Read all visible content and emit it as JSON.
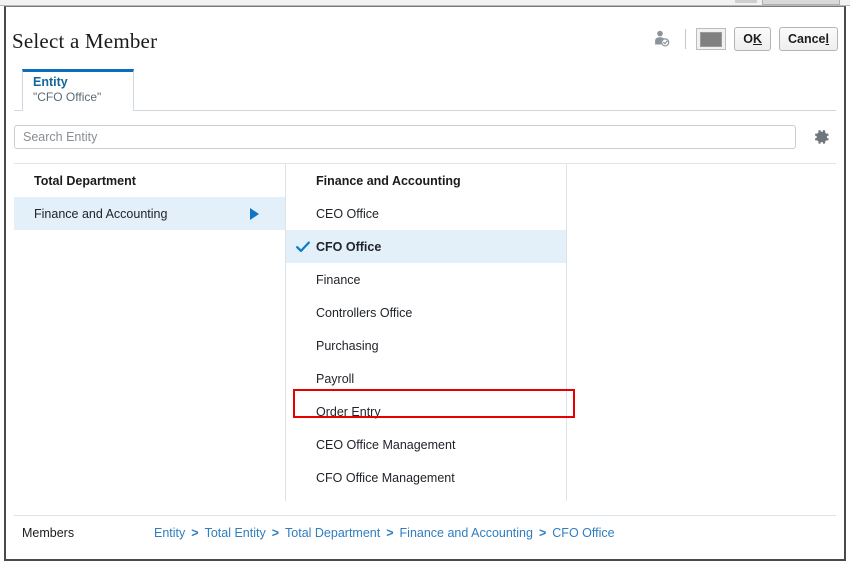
{
  "window": {
    "title": "Select a Member"
  },
  "header": {
    "tools": {
      "member_icon_name": "person-check-icon",
      "swatch_name": "color-swatch-button",
      "ok_label_pre": "O",
      "ok_label_accel": "K",
      "cancel_label_pre": "Cance",
      "cancel_label_accel": "l",
      "ok_label": "OK",
      "cancel_label": "Cancel"
    }
  },
  "tabs": [
    {
      "label": "Entity",
      "sublabel": "\"CFO Office\"",
      "active": true
    }
  ],
  "search": {
    "value": "",
    "placeholder": "Search Entity",
    "settings_icon": "gear-icon"
  },
  "columns": {
    "left": {
      "header": "Total Department",
      "items": [
        {
          "label": "Finance and Accounting",
          "selected": true,
          "has_children": true
        }
      ]
    },
    "middle": {
      "header": "Finance and Accounting",
      "items": [
        {
          "label": "CEO Office",
          "checked": false
        },
        {
          "label": "CFO Office",
          "checked": true,
          "highlighted": true
        },
        {
          "label": "Finance",
          "checked": false
        },
        {
          "label": "Controllers Office",
          "checked": false
        },
        {
          "label": "Purchasing",
          "checked": false
        },
        {
          "label": "Payroll",
          "checked": false
        },
        {
          "label": "Order Entry",
          "checked": false
        },
        {
          "label": "CEO Office Management",
          "checked": false
        },
        {
          "label": "CFO Office Management",
          "checked": false
        }
      ]
    },
    "right": {
      "header": "",
      "items": []
    }
  },
  "footer": {
    "label": "Members",
    "separator": ">",
    "breadcrumbs": [
      "Entity",
      "Total Entity",
      "Total Department",
      "Finance and Accounting",
      "CFO Office"
    ]
  },
  "colors": {
    "accent_blue": "#0a6ebd",
    "link_blue": "#2f7ec0",
    "selection_blue": "#e3eff9",
    "highlight_red": "#e60000",
    "check_blue": "#0f7ac8"
  }
}
